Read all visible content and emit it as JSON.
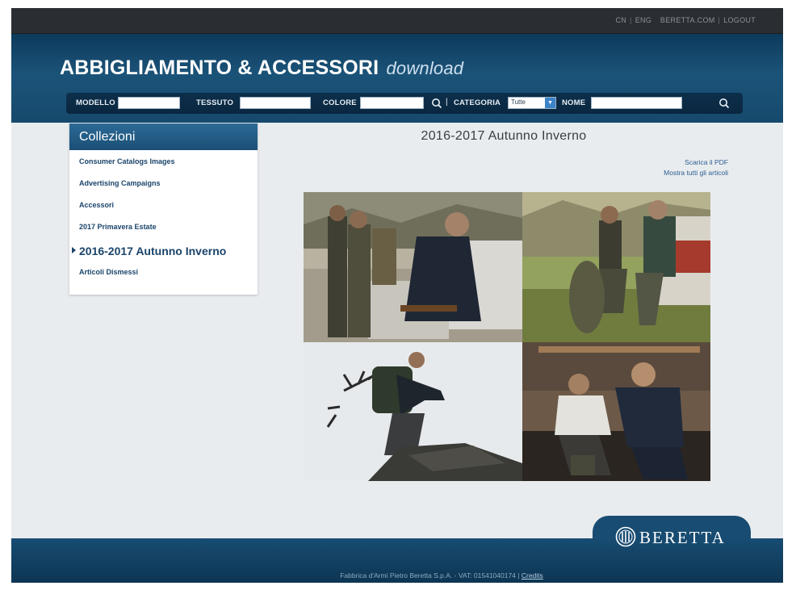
{
  "topbar": {
    "links": [
      "CN",
      "ENG",
      "BERETTA.COM",
      "LOGOUT"
    ]
  },
  "header": {
    "title_main": "ABBIGLIAMENTO & ACCESSORI",
    "title_sub": "download"
  },
  "search": {
    "modello_label": "MODELLO",
    "tessuto_label": "TESSUTO",
    "colore_label": "COLORE",
    "categoria_label": "CATEGORIA",
    "categoria_value": "Tutte",
    "nome_label": "NOME",
    "separator": "|"
  },
  "sidebar": {
    "heading": "Collezioni",
    "items": [
      {
        "label": "Consumer Catalogs Images"
      },
      {
        "label": "Advertising Campaigns"
      },
      {
        "label": "Accessori"
      },
      {
        "label": "2017 Primavera Estate"
      },
      {
        "label": "2016-2017 Autunno Inverno"
      },
      {
        "label": "Articoli Dismessi"
      }
    ]
  },
  "main": {
    "heading": "2016-2017 Autunno Inverno",
    "download_pdf": "Scarica il PDF",
    "show_all": "Mostra tutti gli articoli"
  },
  "footer": {
    "company": "Fabbrica d'Armi Pietro Beretta S.p.A. - VAT: 01541040174 | ",
    "credits": "Credits",
    "logo": "BERETTA"
  },
  "colors": {
    "header": "#1b5378",
    "accent_blue": "#2a5d8f",
    "sidebar_head": "#2c6a96",
    "page_bg": "#e9ecef"
  }
}
